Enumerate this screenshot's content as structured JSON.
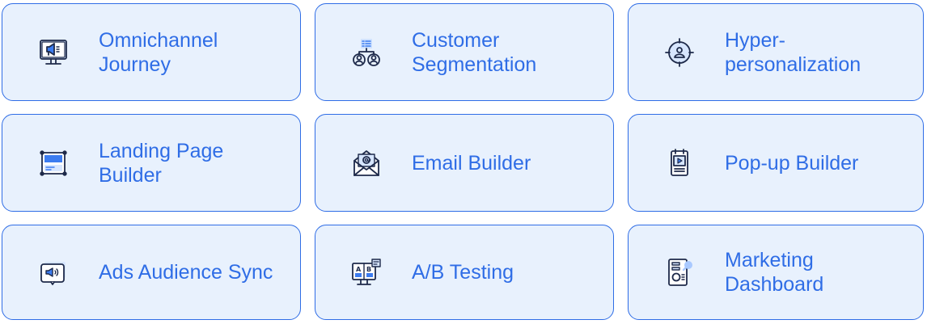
{
  "accent_color": "#2f6de6",
  "card_background": "#e8f1fd",
  "icon_color": "#1e2a4a",
  "features": [
    {
      "label": "Omnichannel Journey",
      "icon": "megaphone-monitor-icon"
    },
    {
      "label": "Customer Segmentation",
      "icon": "segmentation-users-icon"
    },
    {
      "label": "Hyper-personalization",
      "icon": "target-user-icon"
    },
    {
      "label": "Landing Page Builder",
      "icon": "landing-page-icon"
    },
    {
      "label": "Email Builder",
      "icon": "envelope-at-icon"
    },
    {
      "label": "Pop-up Builder",
      "icon": "popup-window-icon"
    },
    {
      "label": "Ads Audience Sync",
      "icon": "ads-megaphone-icon"
    },
    {
      "label": "A/B Testing",
      "icon": "ab-monitor-icon"
    },
    {
      "label": "Marketing Dashboard",
      "icon": "dashboard-report-icon"
    }
  ]
}
